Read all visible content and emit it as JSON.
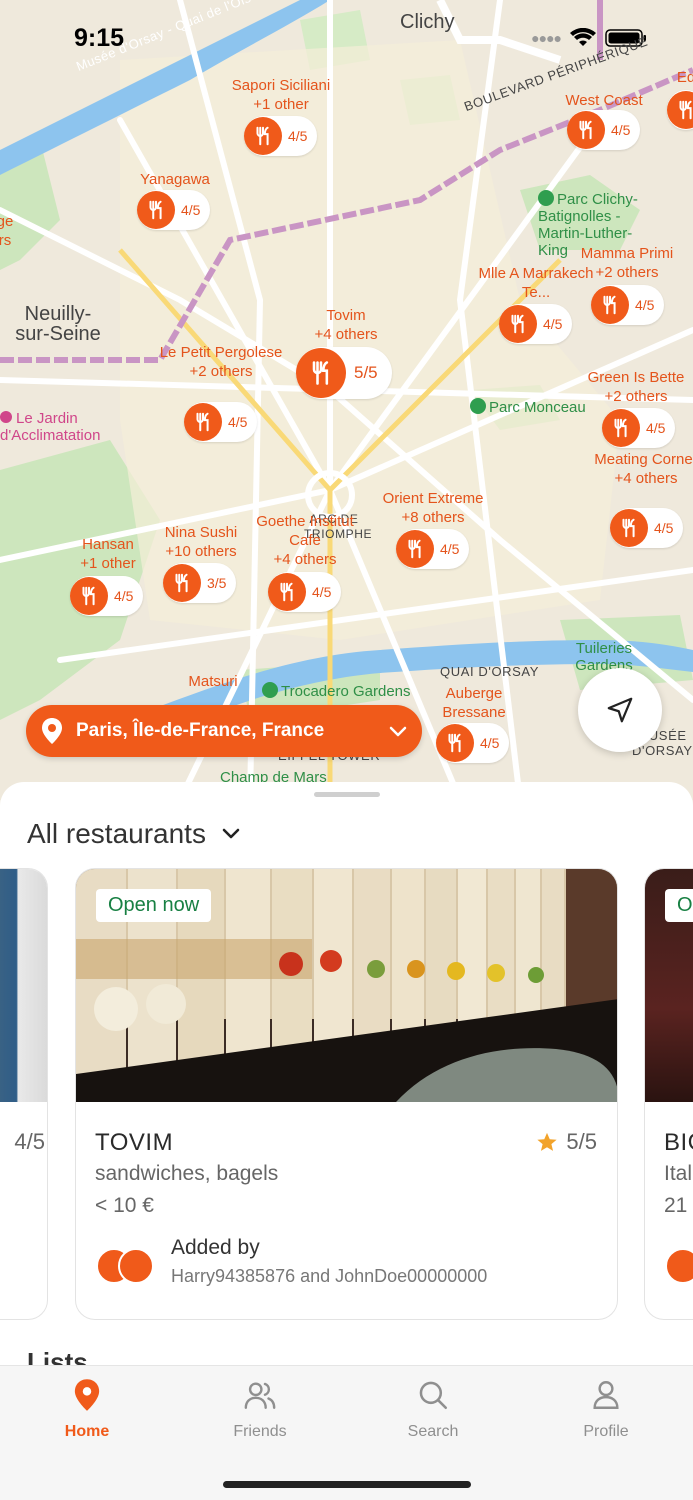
{
  "status_bar": {
    "time": "9:15"
  },
  "map": {
    "place_labels": [
      {
        "text": "Clichy"
      },
      {
        "text": "Neuilly-sur-Seine"
      }
    ],
    "river_label": "Musée d'Orsay - Quai de l'Ois",
    "road_label": "BOULEVARD PÉRIPHÉRIQUE",
    "quai_label": "QUAI D'ORSAY",
    "landmark_label": "ARC DE TRIOMPHE",
    "eiffel_label": "EIFFEL TOWER",
    "musee_label": "MUSÉE D'ORSAY",
    "parks": [
      {
        "text": "Parc Clichy-Batignolles - Martin-Luther-King"
      },
      {
        "text": "Parc Monceau"
      },
      {
        "text": "Tuileries Gardens"
      },
      {
        "text": "Trocadero Gardens"
      },
      {
        "text": "Champ de Mars"
      }
    ],
    "jardin_label": "Le Jardin d'Acclimatation",
    "restaurants": [
      {
        "name": "Sapori Siciliani",
        "extra": "+1 other",
        "rating": "4/5"
      },
      {
        "name": "West Coast",
        "extra": "",
        "rating": "4/5"
      },
      {
        "name": "Yanagawa",
        "extra": "",
        "rating": "4/5"
      },
      {
        "name": "Mamma Primi",
        "extra": "+2 others",
        "rating": "4/5"
      },
      {
        "name": "Mlle A Marrakech Te...",
        "extra": "",
        "rating": "4/5"
      },
      {
        "name": "Tovim",
        "extra": "+4 others",
        "rating": "5/5"
      },
      {
        "name": "Le Petit Pergolese",
        "extra": "+2 others",
        "rating": "4/5"
      },
      {
        "name": "Green Is Bette",
        "extra": "+2 others",
        "rating": "4/5"
      },
      {
        "name": "Meating Corner",
        "extra": "+4 others",
        "rating": "4/5"
      },
      {
        "name": "Orient Extreme",
        "extra": "+8 others",
        "rating": "4/5"
      },
      {
        "name": "Goethe Institut Cafe",
        "extra": "+4 others",
        "rating": "4/5"
      },
      {
        "name": "Nina Sushi",
        "extra": "+10 others",
        "rating": "3/5"
      },
      {
        "name": "Hansan",
        "extra": "+1 other",
        "rating": "4/5"
      },
      {
        "name": "Matsuri",
        "extra": "",
        "rating": ""
      },
      {
        "name": "Auberge Bressane",
        "extra": "",
        "rating": "4/5"
      }
    ],
    "edge_label_right": "Ed",
    "edge_label_left": "ge\nrs"
  },
  "location": {
    "label": "Paris, Île-de-France, France"
  },
  "sheet": {
    "title": "All restaurants",
    "lists_peek": "Lists",
    "left_card_score": "4/5",
    "right_card_name": "BIG",
    "right_card_cuisine": "Ital",
    "right_card_price": "21",
    "right_badge": "O",
    "card": {
      "badge": "Open now",
      "name": "TOVIM",
      "cuisine": "sandwiches, bagels",
      "price": "< 10 €",
      "score": "5/5",
      "added_title": "Added by",
      "added_users": "Harry94385876 and JohnDoe00000000"
    }
  },
  "tabs": [
    {
      "label": "Home",
      "icon": "map-pin-icon",
      "active": true
    },
    {
      "label": "Friends",
      "icon": "users-icon",
      "active": false
    },
    {
      "label": "Search",
      "icon": "search-icon",
      "active": false
    },
    {
      "label": "Profile",
      "icon": "user-icon",
      "active": false
    }
  ],
  "colors": {
    "accent": "#f05a1a",
    "open_badge": "#188043",
    "park": "#2f9e4f"
  }
}
